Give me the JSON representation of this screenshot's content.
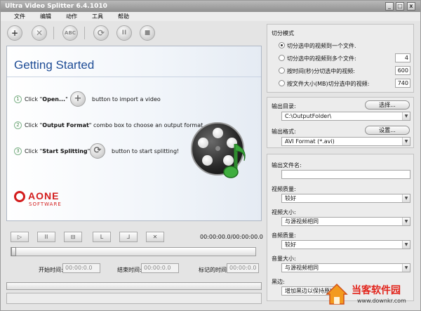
{
  "window": {
    "title": "Ultra Video Splitter 6.4.1010",
    "minimize": "_",
    "maximize": "□",
    "close": "x"
  },
  "menu": [
    "文件",
    "编辑",
    "动作",
    "工具",
    "帮助"
  ],
  "toolbar": {
    "add": "+",
    "remove": "✕",
    "rename": "ABC",
    "refresh": "⟳",
    "pause": "II",
    "stop": "■"
  },
  "getting_started": {
    "title": "Getting Started",
    "steps": [
      {
        "num": "1",
        "pre": "Click \"",
        "bold": "Open...",
        "post": "\"",
        "after_icon": "button to import a video",
        "icon": "+"
      },
      {
        "num": "2",
        "pre": "Click \"",
        "bold": "Output Format",
        "post": "\" combo box to choose an output format"
      },
      {
        "num": "3",
        "pre": "Click \"",
        "bold": "Start Splitting",
        "post": "\"",
        "after_icon": "button to start splitting!",
        "icon": "⟳"
      }
    ],
    "brand": {
      "name": "AONE",
      "sub": "SOFTWARE"
    }
  },
  "player": {
    "buttons": [
      "▷",
      "II",
      "⊟",
      "L",
      "⅃",
      "✕"
    ],
    "timecode": "00:00:00.0/00:00:00.0",
    "start_label": "开始时间:",
    "start_value": "00:00:0.0",
    "end_label": "结束时间:",
    "end_value": "00:00:0.0",
    "mark_label": "标记的时间:",
    "mark_value": "00:00:0.0"
  },
  "split_mode": {
    "heading": "切分模式",
    "options": [
      {
        "label": "切分选中的视频到一个文件.",
        "selected": true,
        "value": ""
      },
      {
        "label": "切分选中的视频到多个文件:",
        "selected": false,
        "value": "4"
      },
      {
        "label": "按时间(秒)分切选中的视频:",
        "selected": false,
        "value": "600"
      },
      {
        "label": "按文件大小(MB)切分选中的视频:",
        "selected": false,
        "value": "740"
      }
    ]
  },
  "output": {
    "dir_label": "输出目录:",
    "dir_button": "选择...",
    "dir_value": "C:\\OutputFolder\\",
    "format_label": "输出格式:",
    "format_button": "设置...",
    "format_value": "AVI Format (*.avi)"
  },
  "settings": {
    "filename_label": "输出文件名:",
    "filename_value": "",
    "video_quality_label": "视频质量:",
    "video_quality_value": "较好",
    "video_size_label": "视频大小:",
    "video_size_value": "与源视频相同",
    "audio_quality_label": "音频质量:",
    "audio_quality_value": "较好",
    "volume_label": "音量大小:",
    "volume_value": "与源视频相同",
    "border_label": "黑边:",
    "border_value": "增加黑边以保持原始"
  },
  "watermark": {
    "name": "当客软件园",
    "url": "www.downkr.com"
  }
}
